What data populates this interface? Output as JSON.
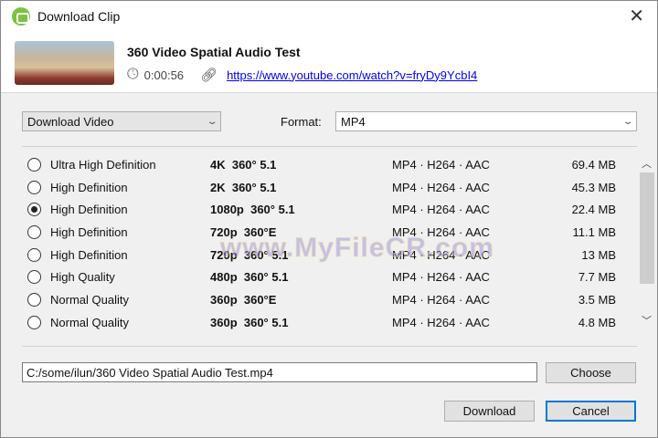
{
  "window": {
    "title": "Download Clip",
    "close_icon": "close-icon"
  },
  "video": {
    "title": "360 Video Spatial Audio Test",
    "duration": "0:00:56",
    "url": "https://www.youtube.com/watch?v=fryDy9YcbI4"
  },
  "mode_select": {
    "value": "Download Video"
  },
  "format": {
    "label": "Format:",
    "value": "MP4"
  },
  "qualities": [
    {
      "quality": "Ultra High Definition",
      "resolution": "4K  360° 5.1",
      "codec": "MP4 · H264 · AAC",
      "size": "69.4 MB",
      "selected": false
    },
    {
      "quality": "High Definition",
      "resolution": "2K  360° 5.1",
      "codec": "MP4 · H264 · AAC",
      "size": "45.3 MB",
      "selected": false
    },
    {
      "quality": "High Definition",
      "resolution": "1080p  360° 5.1",
      "codec": "MP4 · H264 · AAC",
      "size": "22.4 MB",
      "selected": true
    },
    {
      "quality": "High Definition",
      "resolution": "720p  360°E",
      "codec": "MP4 · H264 · AAC",
      "size": "11.1 MB",
      "selected": false
    },
    {
      "quality": "High Definition",
      "resolution": "720p  360° 5.1",
      "codec": "MP4 · H264 · AAC",
      "size": "13 MB",
      "selected": false
    },
    {
      "quality": "High Quality",
      "resolution": "480p  360° 5.1",
      "codec": "MP4 · H264 · AAC",
      "size": "7.7 MB",
      "selected": false
    },
    {
      "quality": "Normal Quality",
      "resolution": "360p  360°E",
      "codec": "MP4 · H264 · AAC",
      "size": "3.5 MB",
      "selected": false
    },
    {
      "quality": "Normal Quality",
      "resolution": "360p  360° 5.1",
      "codec": "MP4 · H264 · AAC",
      "size": "4.8 MB",
      "selected": false
    }
  ],
  "watermark": "www.MyFileCR.com",
  "output": {
    "path": "C:/some/ilun/360 Video Spatial Audio Test.mp4",
    "choose_label": "Choose"
  },
  "actions": {
    "download_label": "Download",
    "cancel_label": "Cancel"
  }
}
